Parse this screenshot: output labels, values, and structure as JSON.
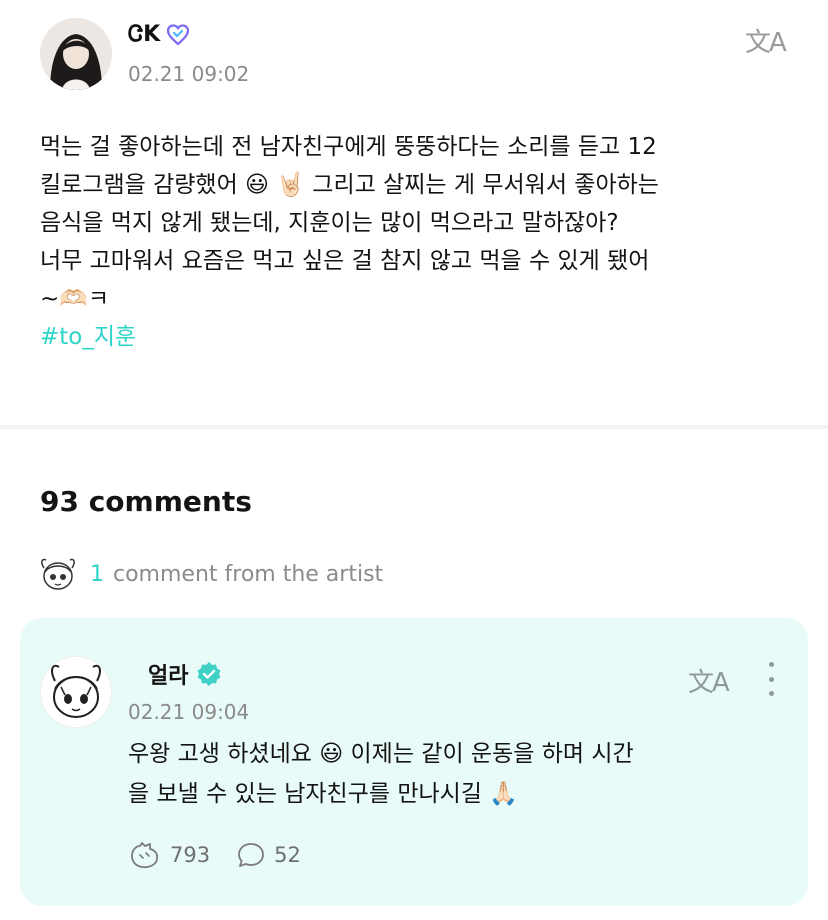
{
  "post": {
    "author": "ᏣK",
    "date": "02.21 09:02",
    "translate_icon": "文A",
    "lines": [
      "먹는 걸 좋아하는데 전 남자친구에게 뚱뚱하다는 소리를 듣고 12",
      "킬로그램을 감량했어 😃 🤘🏻 그리고 살찌는 게 무서워서 좋아하는",
      "음식을 먹지 않게 됐는데, 지훈이는 많이 먹으라고 말하잖아?",
      "너무 고마워서 요즘은 먹고 싶은 걸 참지 않고 먹을 수 있게 됐어",
      "~🫶🏻ㅋ"
    ],
    "hashtag": "#to_지훈"
  },
  "comments": {
    "title": "93 comments",
    "artist_count": "1",
    "artist_label": "comment from the artist"
  },
  "artist_comment": {
    "name": "얼라",
    "date": "02.21 09:04",
    "translate_icon": "文A",
    "lines": [
      "우왕 고생 하셨네요 😃 이제는 같이 운동을 하며 시간",
      "을 보낼 수 있는 남자친구를 만나시길 🙏🏻"
    ],
    "likes": "793",
    "replies": "52"
  },
  "colors": {
    "accent": "#2ed4c8",
    "card_bg": "#e9fbf8",
    "muted": "#8a8a8a"
  }
}
